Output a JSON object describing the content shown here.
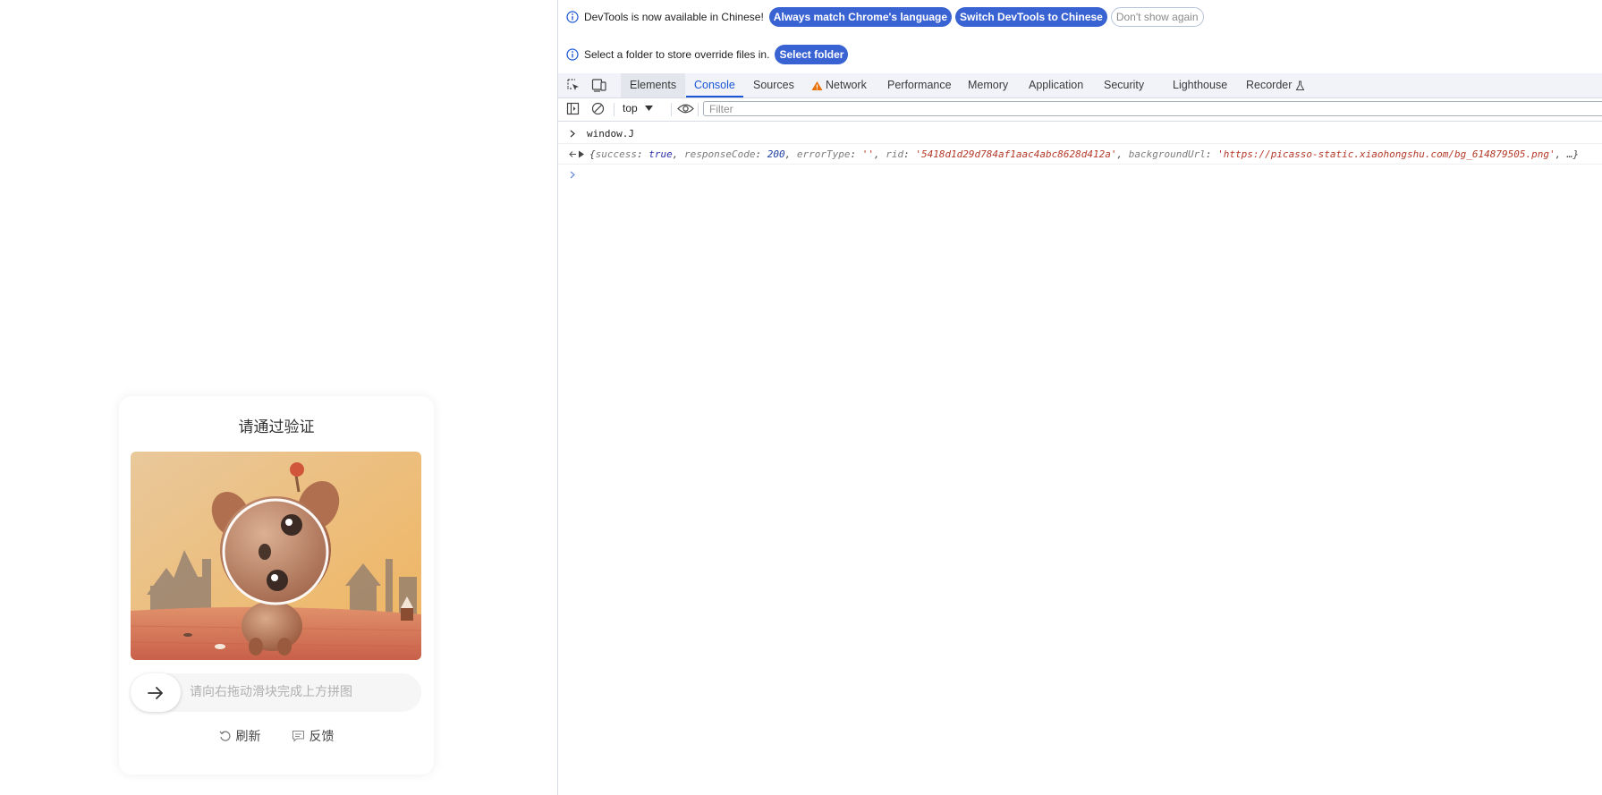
{
  "captcha": {
    "title": "请通过验证",
    "slider_hint": "请向右拖动滑块完成上方拼图",
    "refresh_label": "刷新",
    "feedback_label": "反馈",
    "puzzle_progress": 0
  },
  "devtools": {
    "infobar_language": {
      "message": "DevTools is now available in Chinese!",
      "match_button": "Always match Chrome's language",
      "switch_button": "Switch DevTools to Chinese",
      "dismiss_button": "Don't show again"
    },
    "infobar_overrides": {
      "message": "Select a folder to store override files in.",
      "select_button": "Select folder"
    },
    "tabs": {
      "elements": "Elements",
      "console": "Console",
      "sources": "Sources",
      "network": "Network",
      "performance": "Performance",
      "memory": "Memory",
      "application": "Application",
      "security": "Security",
      "lighthouse": "Lighthouse",
      "recorder": "Recorder"
    },
    "active_tab": "console",
    "console": {
      "context": "top",
      "filter_placeholder": "Filter",
      "input_command": "window.J",
      "result": {
        "open_brace": "{",
        "k_success": "success",
        "v_success": "true",
        "k_responseCode": "responseCode",
        "v_responseCode": "200",
        "k_errorType": "errorType",
        "v_errorType": "''",
        "k_rid": "rid",
        "v_rid": "'5418d1d29d784af1aac4abc8628d412a'",
        "k_backgroundUrl": "backgroundUrl",
        "v_backgroundUrl": "'https://picasso-static.xiaohongshu.com/bg_614879505.png'",
        "tail": ", …}"
      }
    }
  },
  "colors": {
    "accent": "#3962d3",
    "active_tab": "#1a56d6",
    "warning": "#e8710a",
    "string_value": "#b53a2a",
    "number_value": "#1d3fa0"
  }
}
